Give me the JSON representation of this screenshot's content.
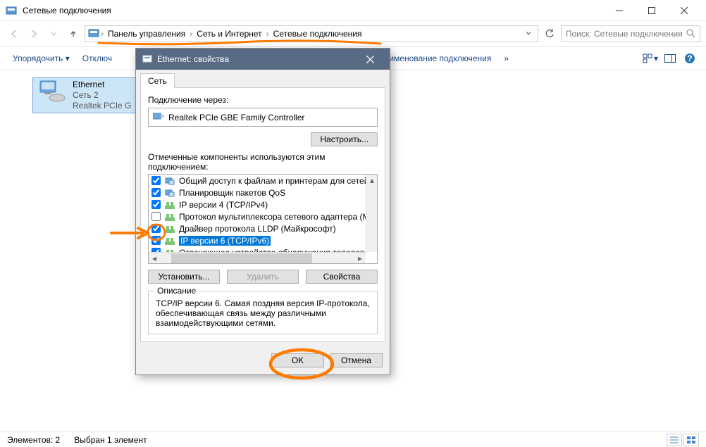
{
  "window": {
    "title": "Сетевые подключения"
  },
  "breadcrumb": {
    "root_icon": "control-panel",
    "items": [
      "Панель управления",
      "Сеть и Интернет",
      "Сетевые подключения"
    ]
  },
  "search": {
    "placeholder": "Поиск: Сетевые подключения"
  },
  "commands": {
    "organize": "Упорядочить",
    "disable": "Отключ",
    "rename": "реименование подключения",
    "more": "»"
  },
  "adapter_item": {
    "name": "Ethernet",
    "network": "Сеть  2",
    "device": "Realtek PCIe G"
  },
  "statusbar": {
    "elements": "Элементов: 2",
    "selected": "Выбран 1 элемент"
  },
  "dialog": {
    "title": "Ethernet: свойства",
    "tab": "Сеть",
    "connect_via": "Подключение через:",
    "adapter": "Realtek PCIe GBE Family Controller",
    "configure": "Настроить...",
    "components_label": "Отмеченные компоненты используются этим подключением:",
    "components": [
      {
        "checked": true,
        "label": "Общий доступ к файлам и принтерам для сетей Mi",
        "kind": "net"
      },
      {
        "checked": true,
        "label": "Планировщик пакетов QoS",
        "kind": "net"
      },
      {
        "checked": true,
        "label": "IP версии 4 (TCP/IPv4)",
        "kind": "proto"
      },
      {
        "checked": false,
        "label": "Протокол мультиплексора сетевого адаптера (Ма",
        "kind": "proto"
      },
      {
        "checked": true,
        "label": "Драйвер протокола LLDP (Майкрософт)",
        "kind": "proto"
      },
      {
        "checked": true,
        "label": "IP версии 6 (TCP/IPv6)",
        "kind": "proto",
        "selected": true
      },
      {
        "checked": true,
        "label": "Отвечающее устройство обнаружения топологии к",
        "kind": "proto"
      }
    ],
    "install": "Установить...",
    "uninstall": "Удалить",
    "properties": "Свойства",
    "desc_legend": "Описание",
    "desc_text": "TCP/IP версии 6. Самая поздняя версия IP-протокола, обеспечивающая связь между различными взаимодействующими сетями.",
    "ok": "OK",
    "cancel": "Отмена"
  }
}
